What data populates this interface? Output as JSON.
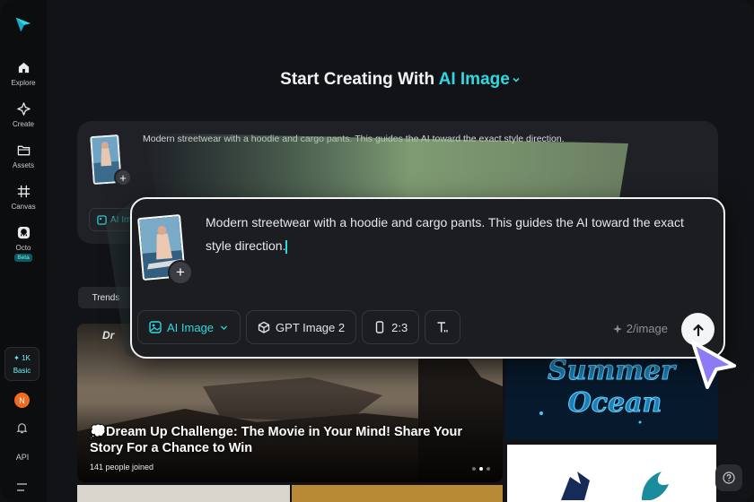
{
  "sidebar": {
    "items": [
      {
        "label": "Explore",
        "icon": "home-icon"
      },
      {
        "label": "Create",
        "icon": "sparkle-icon"
      },
      {
        "label": "Assets",
        "icon": "folder-icon"
      },
      {
        "label": "Canvas",
        "icon": "canvas-icon"
      },
      {
        "label": "Octo",
        "icon": "octo-icon"
      }
    ],
    "beta": "Beta",
    "credits_amount": "✦ 1K",
    "credits_plan": "Basic",
    "avatar_initial": "N",
    "api_label": "API"
  },
  "heading": {
    "prefix": "Start Creating With",
    "accent": "AI Image"
  },
  "prompt": {
    "text": "Modern streetwear with a hoodie and cargo pants. This guides the AI toward the exact style direction.",
    "mode_short": "AI Im",
    "mode": "AI Image",
    "model": "GPT Image 2",
    "ratio": "2:3",
    "cost": "2/image"
  },
  "trends_tab": "Trends",
  "hero": {
    "logo_text": "Dr",
    "title": "💭Dream Up Challenge: The Movie in Your Mind! Share Your Story For a Chance to Win",
    "participants": "141 people joined"
  },
  "ocean_card": {
    "line1": "Summer",
    "line2": "Ocean"
  },
  "colors": {
    "accent": "#2fd8e0",
    "avatar": "#f26a21",
    "background": "#121316",
    "card": "#1f2126"
  }
}
